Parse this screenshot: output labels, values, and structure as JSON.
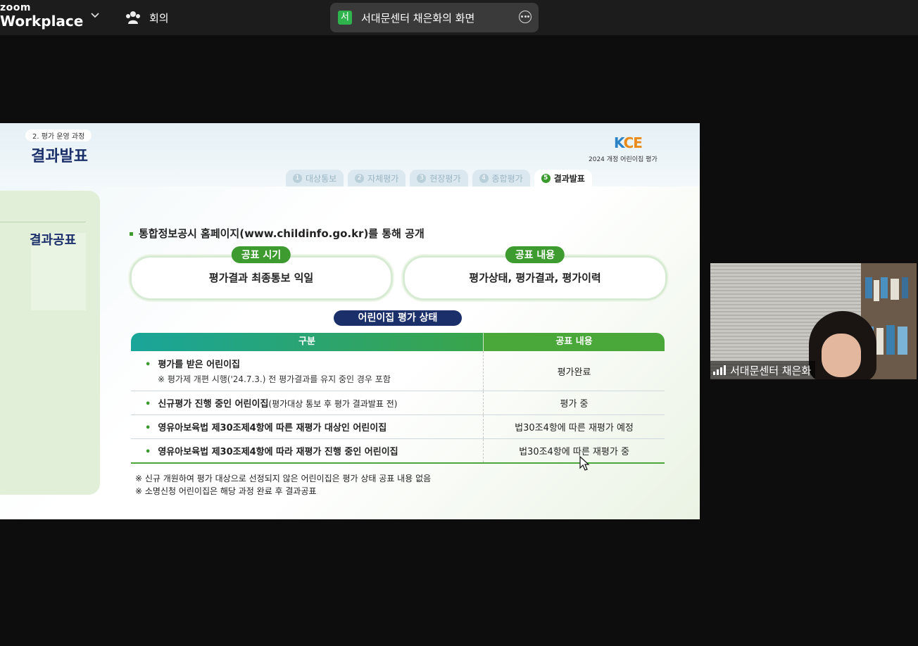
{
  "topbar": {
    "brand_top": "zoom",
    "brand_bottom": "Workplace",
    "meeting_label": "회의",
    "share_avatar": "서",
    "share_title": "서대문센터 채은화의 화면",
    "icons": [
      "chevron-down-icon",
      "participants-icon",
      "more-icon"
    ]
  },
  "slide": {
    "section": "2. 평가 운영 과정",
    "title": "결과발표",
    "brand_k": "K",
    "brand_ce": "CE",
    "brand_sub": "2024 개정 어린이집 평가",
    "tabs": [
      {
        "num": "1",
        "label": "대상통보"
      },
      {
        "num": "2",
        "label": "자체평가"
      },
      {
        "num": "3",
        "label": "현장평가"
      },
      {
        "num": "4",
        "label": "종합평가"
      },
      {
        "num": "5",
        "label": "결과발표",
        "active": true
      }
    ],
    "side_label": "결과공표",
    "bullet": "통합정보공시 홈페이지(www.childinfo.go.kr)를 통해 공개",
    "timing_label": "공표 시기",
    "timing_value": "평가결과 최종통보 익일",
    "content_label": "공표 내용",
    "content_value": "평가상태, 평가결과, 평가이력",
    "status_title": "어린이집 평가 상태",
    "table": {
      "headers": [
        "구분",
        "공표 내용"
      ],
      "rows": [
        {
          "main": "평가를 받은 어린이집",
          "extra": "",
          "sub": "※ 평가제 개편 시행('24.7.3.) 전 평가결과를 유지 중인 경우 포함",
          "value": "평가완료"
        },
        {
          "main": "신규평가 진행 중인 어린이집",
          "extra": "(평가대상 통보 후 평가 결과발표 전)",
          "sub": "",
          "value": "평가 중"
        },
        {
          "main": "영유아보육법 제30조제4항에 따른 재평가 대상인 어린이집",
          "extra": "",
          "sub": "",
          "value": "법30조4항에 따른 재평가 예정"
        },
        {
          "main": "영유아보육법 제30조제4항에 따라 재평가 진행 중인 어린이집",
          "extra": "",
          "sub": "",
          "value": "법30조4항에 따른 재평가 중"
        }
      ]
    },
    "notes": [
      "※ 신규 개원하여 평가 대상으로 선정되지 않은 어린이집은 평가 상태 공표 내용 없음",
      "※ 소명신청 어린이집은 해당 과정 완료 후 결과공표"
    ]
  },
  "video": {
    "name": "서대문센터 채은화",
    "icons": [
      "signal-icon"
    ]
  },
  "colors": {
    "accent_green": "#3e9b2f",
    "navy": "#1b2f6b",
    "zoom_bar": "#1c1c1c",
    "share_avatar": "#2eb34d"
  }
}
